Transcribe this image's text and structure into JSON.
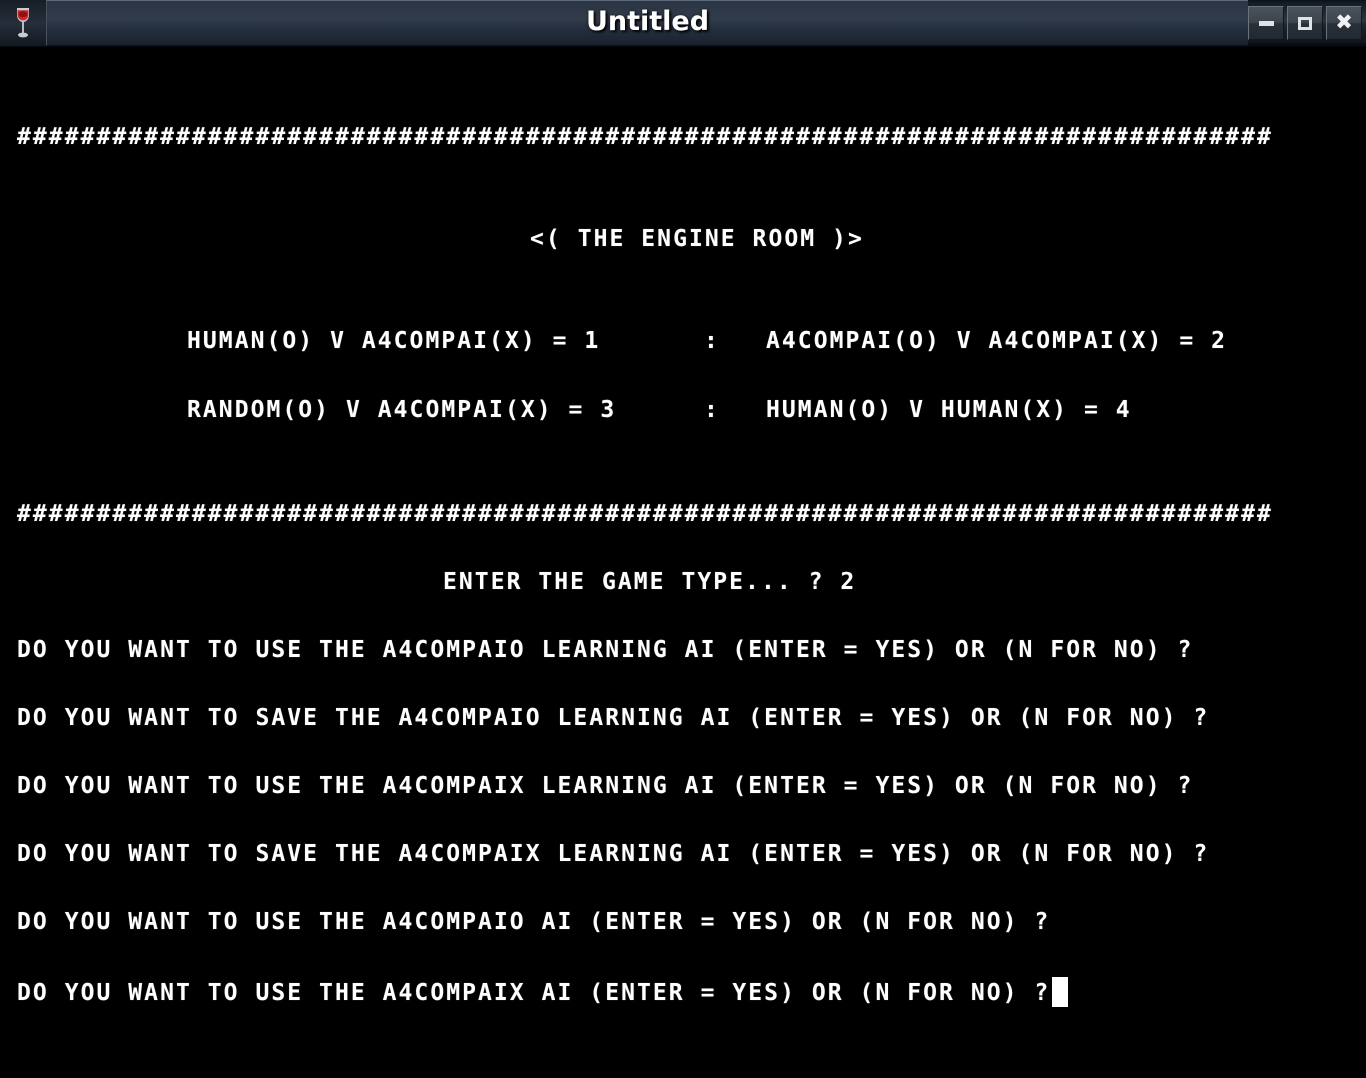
{
  "window": {
    "title": "Untitled",
    "app_icon": "wine-glass-icon",
    "buttons": {
      "minimize": "minimize-icon",
      "maximize": "maximize-icon",
      "close": "close-icon"
    }
  },
  "colors": {
    "terminal_background": "#000000",
    "terminal_foreground": "#ffffff",
    "titlebar_background": "#2c3543",
    "titlebar_text": "#ffffff"
  },
  "terminal": {
    "separator_top": "###############################################################################",
    "separator_bottom": "###############################################################################",
    "heading": "<( THE ENGINE ROOM )>",
    "menu": {
      "row1_left": "HUMAN(O) V A4COMPAI(X) = 1",
      "row1_sep": ":",
      "row1_right": "A4COMPAI(O) V A4COMPAI(X) = 2",
      "row2_left": "RANDOM(O) V A4COMPAI(X) = 3",
      "row2_sep": ":",
      "row2_right": "HUMAN(O) V HUMAN(X) = 4"
    },
    "prompt_game_type": "ENTER THE GAME TYPE... ? 2",
    "questions": [
      "DO YOU WANT TO USE THE A4COMPAIO LEARNING AI (ENTER = YES) OR (N FOR NO) ?",
      "DO YOU WANT TO SAVE THE A4COMPAIO LEARNING AI (ENTER = YES) OR (N FOR NO) ?",
      "DO YOU WANT TO USE THE A4COMPAIX LEARNING AI (ENTER = YES) OR (N FOR NO) ?",
      "DO YOU WANT TO SAVE THE A4COMPAIX LEARNING AI (ENTER = YES) OR (N FOR NO) ?",
      "DO YOU WANT TO USE THE A4COMPAIO AI (ENTER = YES) OR (N FOR NO) ?",
      "DO YOU WANT TO USE THE A4COMPAIX AI (ENTER = YES) OR (N FOR NO) ?"
    ],
    "cursor_visible": true
  }
}
